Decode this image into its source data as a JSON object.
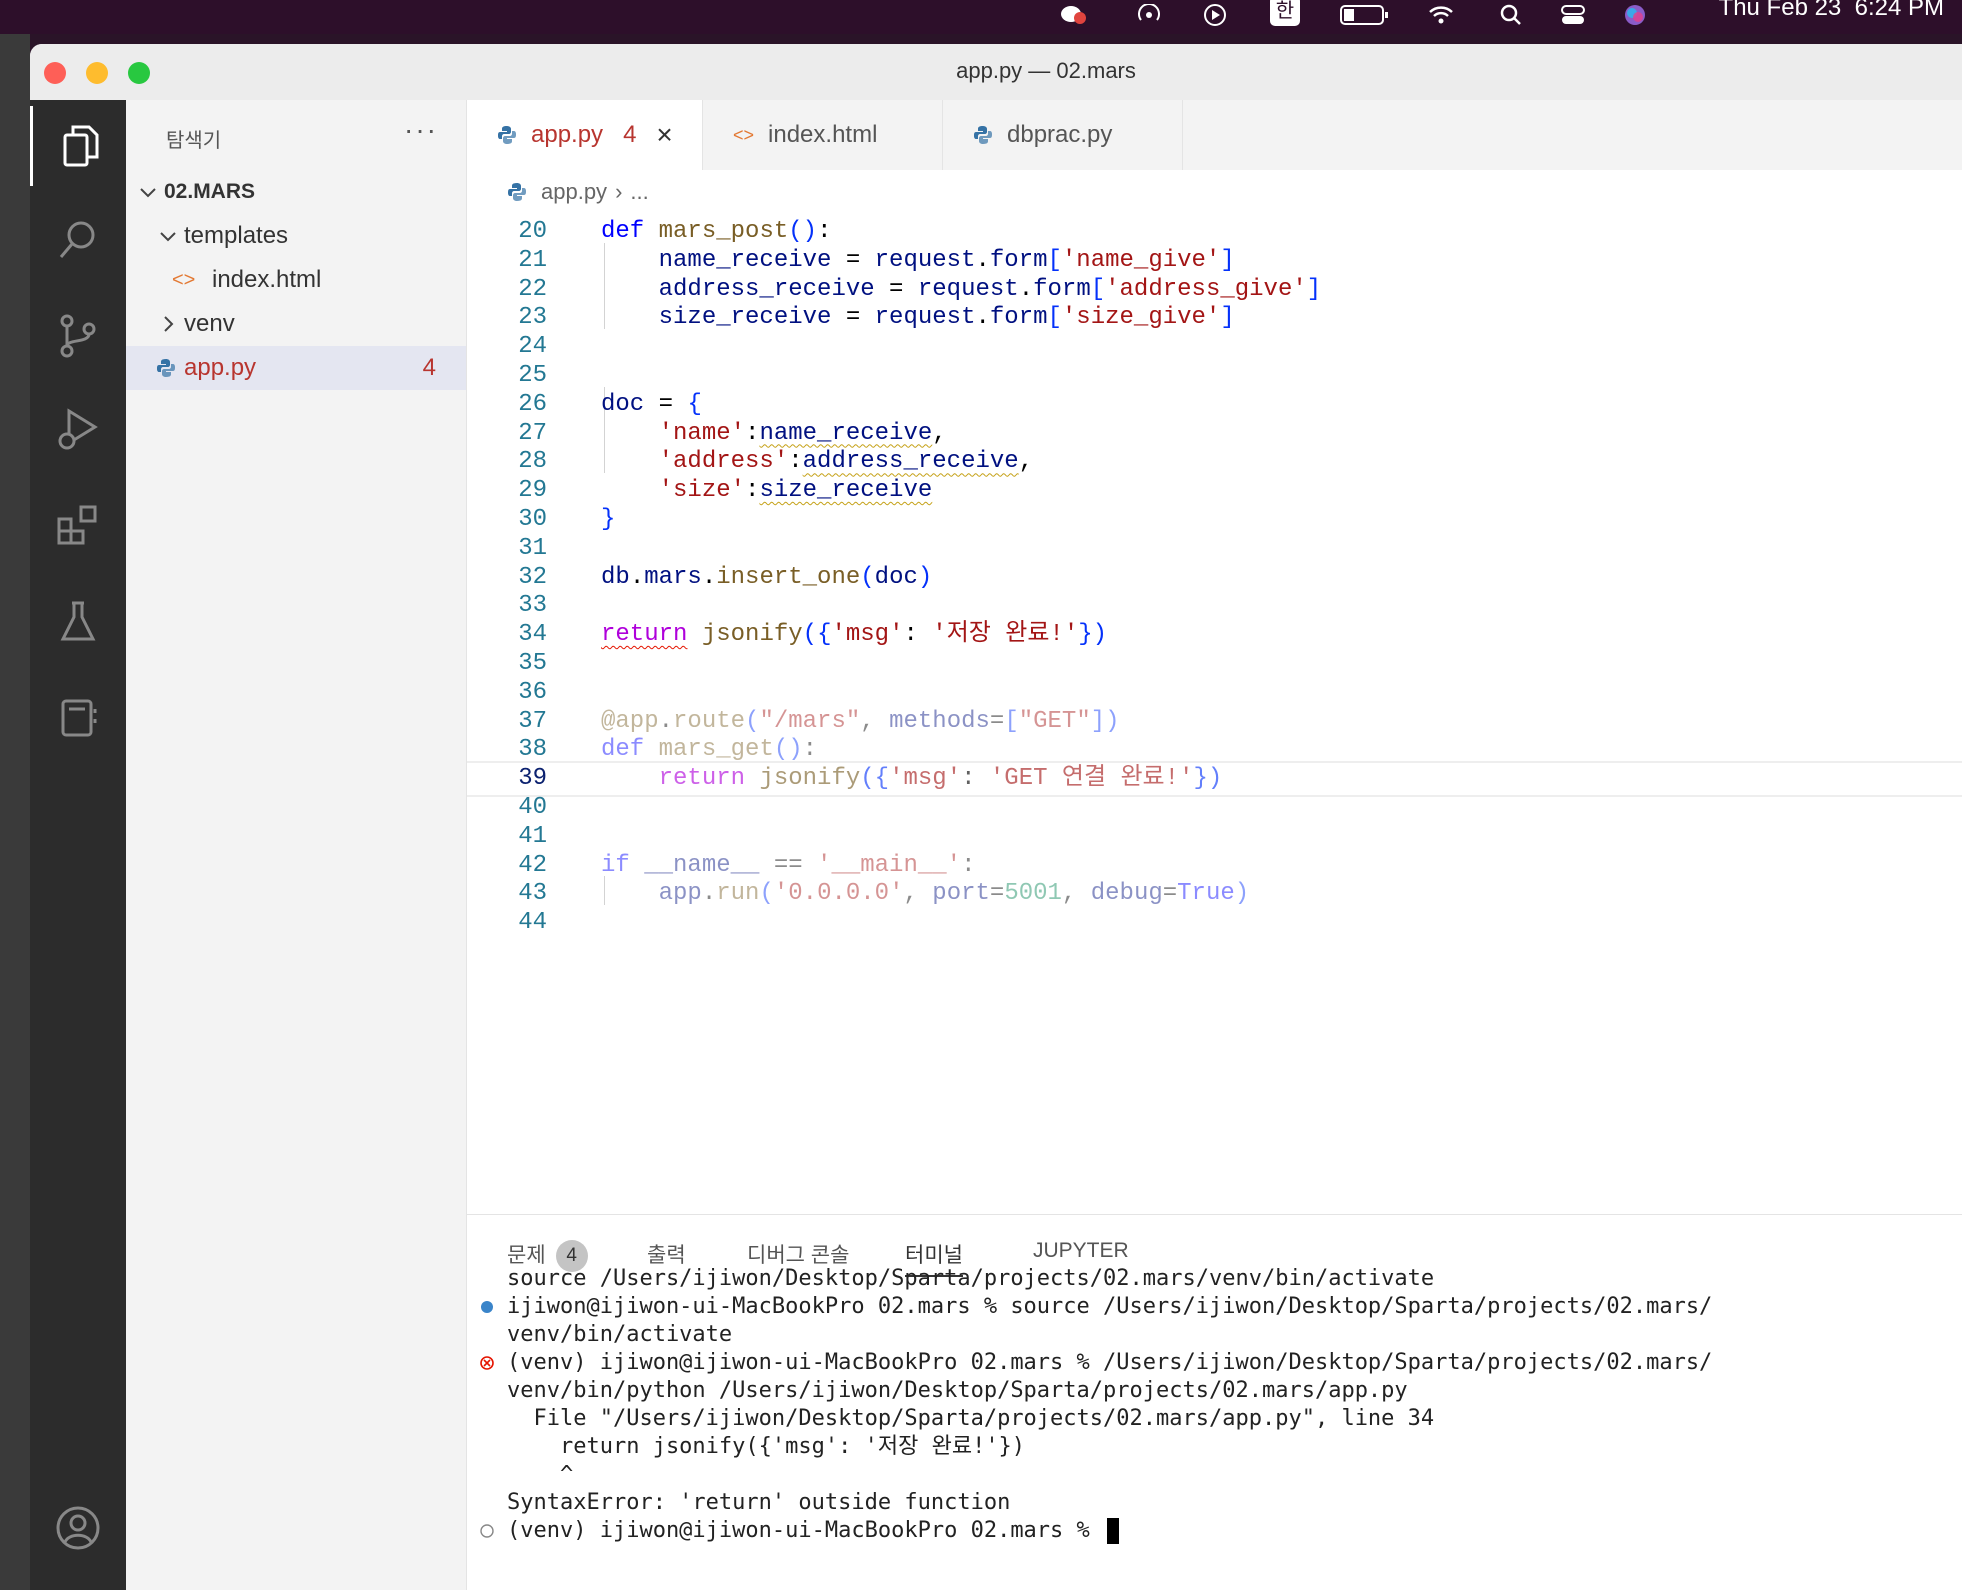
{
  "menubar": {
    "clock": "Thu Feb 23  6:24 PM",
    "icons": [
      "notification-icon",
      "airdrop-icon",
      "play-icon",
      "input-source-icon",
      "battery-icon",
      "wifi-icon",
      "spotlight-icon",
      "control-center-icon",
      "siri-icon"
    ],
    "input_source": "한"
  },
  "window": {
    "title": "app.py — 02.mars"
  },
  "activity_bar": {
    "items": [
      "explorer-icon",
      "search-icon",
      "source-control-icon",
      "run-debug-icon",
      "extensions-icon",
      "testing-icon",
      "notebook-icon",
      "account-icon"
    ]
  },
  "sidebar": {
    "title": "탐색기",
    "more": "···",
    "root": "02.MARS",
    "items": [
      {
        "label": "templates",
        "type": "folder",
        "expanded": true
      },
      {
        "label": "index.html",
        "type": "html"
      },
      {
        "label": "venv",
        "type": "folder",
        "expanded": false
      },
      {
        "label": "app.py",
        "type": "python",
        "badge": "4"
      }
    ]
  },
  "tabs": [
    {
      "label": "app.py",
      "badge": "4",
      "active": true,
      "close": "×"
    },
    {
      "label": "index.html",
      "active": false
    },
    {
      "label": "dbprac.py",
      "active": false
    }
  ],
  "breadcrumb": {
    "file": "app.py",
    "sep": "›",
    "rest": "..."
  },
  "code": {
    "lines": [
      {
        "n": "20",
        "text": "def mars_post():"
      },
      {
        "n": "21",
        "text": "    name_receive = request.form['name_give']"
      },
      {
        "n": "22",
        "text": "    address_receive = request.form['address_give']"
      },
      {
        "n": "23",
        "text": "    size_receive = request.form['size_give']"
      },
      {
        "n": "24",
        "text": ""
      },
      {
        "n": "25",
        "text": ""
      },
      {
        "n": "26",
        "text": "doc = {"
      },
      {
        "n": "27",
        "text": "    'name':name_receive,"
      },
      {
        "n": "28",
        "text": "    'address':address_receive,"
      },
      {
        "n": "29",
        "text": "    'size':size_receive"
      },
      {
        "n": "30",
        "text": "}"
      },
      {
        "n": "31",
        "text": ""
      },
      {
        "n": "32",
        "text": "db.mars.insert_one(doc)"
      },
      {
        "n": "33",
        "text": ""
      },
      {
        "n": "34",
        "text": "return jsonify({'msg': '저장 완료!'})"
      },
      {
        "n": "35",
        "text": ""
      },
      {
        "n": "36",
        "text": ""
      },
      {
        "n": "37",
        "text": "@app.route(\"/mars\", methods=[\"GET\"])"
      },
      {
        "n": "38",
        "text": "def mars_get():"
      },
      {
        "n": "39",
        "text": "    return jsonify({'msg': 'GET 연결 완료!'})"
      },
      {
        "n": "40",
        "text": ""
      },
      {
        "n": "41",
        "text": ""
      },
      {
        "n": "42",
        "text": "if __name__ == '__main__':"
      },
      {
        "n": "43",
        "text": "    app.run('0.0.0.0', port=5001, debug=True)"
      },
      {
        "n": "44",
        "text": ""
      }
    ],
    "current_line": "39"
  },
  "panel": {
    "tabs": [
      {
        "label": "문제",
        "badge": "4"
      },
      {
        "label": "출력"
      },
      {
        "label": "디버그 콘솔"
      },
      {
        "label": "터미널",
        "active": true
      },
      {
        "label": "JUPYTER"
      }
    ],
    "terminal": [
      {
        "text": "source /Users/ijiwon/Desktop/Sparta/projects/02.mars/venv/bin/activate",
        "mark": ""
      },
      {
        "text": "ijiwon@ijiwon-ui-MacBookPro 02.mars % source /Users/ijiwon/Desktop/Sparta/projects/02.mars/",
        "mark": "blue"
      },
      {
        "text": "venv/bin/activate",
        "mark": ""
      },
      {
        "text": "(venv) ijiwon@ijiwon-ui-MacBookPro 02.mars % /Users/ijiwon/Desktop/Sparta/projects/02.mars/",
        "mark": "error"
      },
      {
        "text": "venv/bin/python /Users/ijiwon/Desktop/Sparta/projects/02.mars/app.py",
        "mark": ""
      },
      {
        "text": "  File \"/Users/ijiwon/Desktop/Sparta/projects/02.mars/app.py\", line 34",
        "mark": ""
      },
      {
        "text": "    return jsonify({'msg': '저장 완료!'})",
        "mark": ""
      },
      {
        "text": "    ^",
        "mark": ""
      },
      {
        "text": "SyntaxError: 'return' outside function",
        "mark": ""
      },
      {
        "text": "(venv) ijiwon@ijiwon-ui-MacBookPro 02.mars % ",
        "mark": "empty"
      }
    ]
  },
  "colors": {
    "accent_error": "#b8352f",
    "keyword": "#0000ff",
    "string": "#a31515",
    "function": "#795e26",
    "variable": "#001080"
  }
}
